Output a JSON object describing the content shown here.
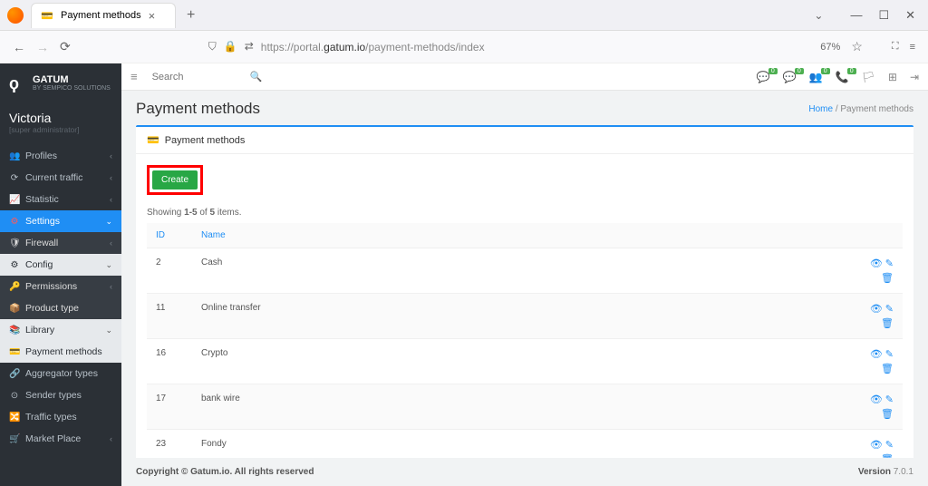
{
  "browser": {
    "tab_title": "Payment methods",
    "url_pre": "https://portal.",
    "url_domain": "gatum.io",
    "url_path": "/payment-methods/index",
    "zoom": "67%"
  },
  "brand": {
    "name": "GATUM",
    "sub": "BY SEMPICO SOLUTIONS"
  },
  "user": {
    "name": "Victoria",
    "role": "[super administrator]"
  },
  "sidebar": {
    "items": [
      {
        "icon": "👥",
        "label": "Profiles",
        "chev": true
      },
      {
        "icon": "⟳",
        "label": "Current traffic",
        "chev": true
      },
      {
        "icon": "📈",
        "label": "Statistic",
        "chev": true
      },
      {
        "icon": "⚙",
        "label": "Settings",
        "chev": true,
        "active": true
      },
      {
        "icon": "🛡",
        "label": "Firewall",
        "chev": true,
        "dark": true
      },
      {
        "icon": "⚙",
        "label": "Config",
        "chev": true,
        "light": true
      },
      {
        "icon": "🔑",
        "label": "Permissions",
        "chev": true,
        "dark": true
      },
      {
        "icon": "📦",
        "label": "Product type",
        "dark": true
      },
      {
        "icon": "📚",
        "label": "Library",
        "chev": true,
        "light": true
      },
      {
        "icon": "💳",
        "label": "Payment methods",
        "light": true,
        "sel": true
      },
      {
        "icon": "🔗",
        "label": "Aggregator types"
      },
      {
        "icon": "⊙",
        "label": "Sender types"
      },
      {
        "icon": "🔀",
        "label": "Traffic types"
      },
      {
        "icon": "🛒",
        "label": "Market Place",
        "chev": true
      }
    ]
  },
  "search_placeholder": "Search",
  "top_badges": [
    {
      "icon": "💬",
      "val": "0"
    },
    {
      "icon": "💬",
      "val": "0",
      "red": true
    },
    {
      "icon": "👥",
      "val": "0",
      "red": true
    },
    {
      "icon": "📞",
      "val": "0"
    }
  ],
  "page": {
    "title": "Payment methods",
    "crumb_home": "Home",
    "crumb_here": "Payment methods",
    "panel_title": "Payment methods",
    "create_label": "Create",
    "showing_pre": "Showing ",
    "showing_range": "1-5",
    "showing_mid": " of ",
    "showing_total": "5",
    "showing_post": " items.",
    "col_id": "ID",
    "col_name": "Name",
    "rows": [
      {
        "id": "2",
        "name": "Cash"
      },
      {
        "id": "11",
        "name": "Online transfer"
      },
      {
        "id": "16",
        "name": "Crypto"
      },
      {
        "id": "17",
        "name": "bank wire"
      },
      {
        "id": "23",
        "name": "Fondy"
      }
    ]
  },
  "footer": {
    "left": "Copyright © Gatum.io. All rights reserved",
    "ver_label": "Version ",
    "ver": "7.0.1"
  }
}
